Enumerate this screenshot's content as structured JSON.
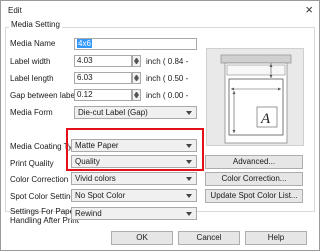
{
  "window": {
    "title": "Edit",
    "close_glyph": "×"
  },
  "group": {
    "title": "Media Setting"
  },
  "fields": {
    "media_name": {
      "label": "Media Name",
      "value": "4x6"
    },
    "label_width": {
      "label": "Label width",
      "value": "4.03",
      "unit": "inch ( 0.84 -"
    },
    "label_length": {
      "label": "Label length",
      "value": "6.03",
      "unit": "inch ( 0.50 -"
    },
    "gap": {
      "label": "Gap between labels",
      "value": "0.12",
      "unit": "inch ( 0.00 -"
    },
    "media_form": {
      "label": "Media Form",
      "value": "Die-cut Label (Gap)"
    },
    "media_coating": {
      "label": "Media Coating Type",
      "value": "Matte Paper"
    },
    "print_quality": {
      "label": "Print Quality",
      "value": "Quality"
    },
    "color_correction": {
      "label": "Color Correction Mode",
      "value": "Vivid colors"
    },
    "spot_color": {
      "label": "Spot Color Setting",
      "value": "No Spot Color"
    },
    "settings_handling": {
      "label": "Settings For Paper Handling After Print",
      "value": "Rewind"
    }
  },
  "buttons": {
    "advanced": "Advanced...",
    "color_correction": "Color Correction...",
    "update_spot": "Update Spot Color List...",
    "ok": "OK",
    "cancel": "Cancel",
    "help": "Help"
  },
  "preview": {
    "letter": "A"
  },
  "colors": {
    "highlight": "#e3101a",
    "selection": "#3399ff"
  }
}
